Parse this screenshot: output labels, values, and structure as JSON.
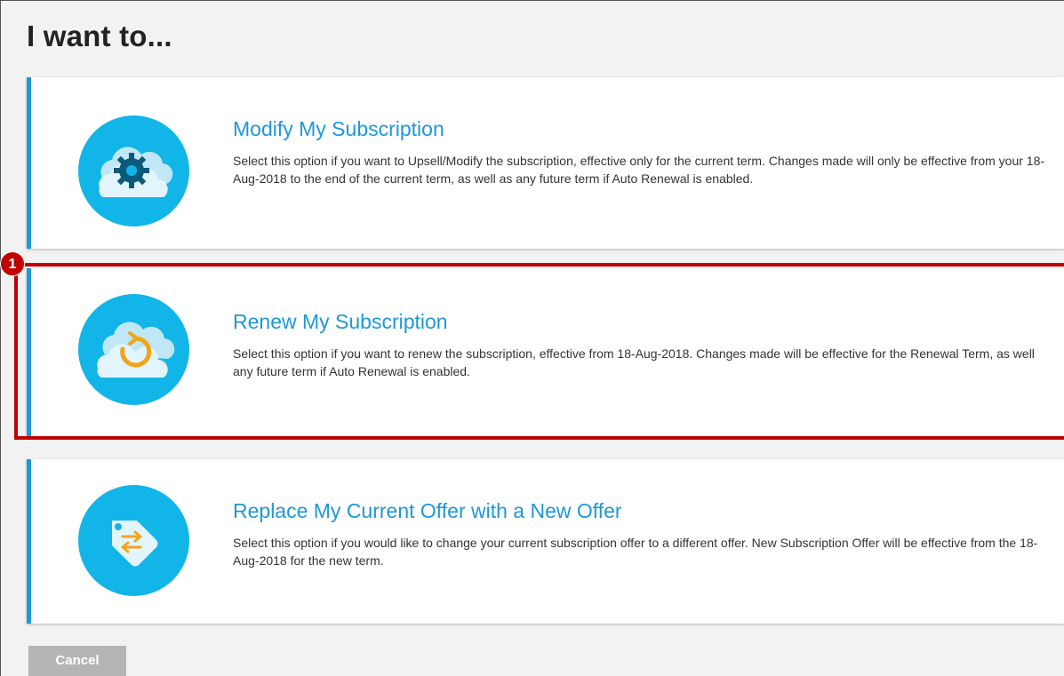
{
  "page": {
    "title": "I want to..."
  },
  "options": [
    {
      "title": "Modify My Subscription",
      "description": "Select this option if you want to Upsell/Modify the subscription, effective only for the current term. Changes made will only be effective from your 18-Aug-2018 to the end of the current term, as well as any future term if Auto Renewal is enabled.",
      "icon": "cloud-gear-icon"
    },
    {
      "title": "Renew My Subscription",
      "description": "Select this option if you want to renew the subscription, effective from 18-Aug-2018. Changes made will be effective for the Renewal Term, as well any future term if Auto Renewal is enabled.",
      "icon": "cloud-renew-icon"
    },
    {
      "title": "Replace My Current Offer with a New Offer",
      "description": "Select this option if you would like to change your current subscription offer to a different offer. New Subscription Offer will be effective from the 18-Aug-2018 for the new term.",
      "icon": "tag-swap-icon"
    }
  ],
  "annotation": {
    "step": "1"
  },
  "actions": {
    "cancel_label": "Cancel"
  },
  "colors": {
    "accent": "#1e98d7",
    "icon_bg": "#12b5e8",
    "highlight": "#c00000",
    "cancel_bg": "#b5b5b5"
  }
}
